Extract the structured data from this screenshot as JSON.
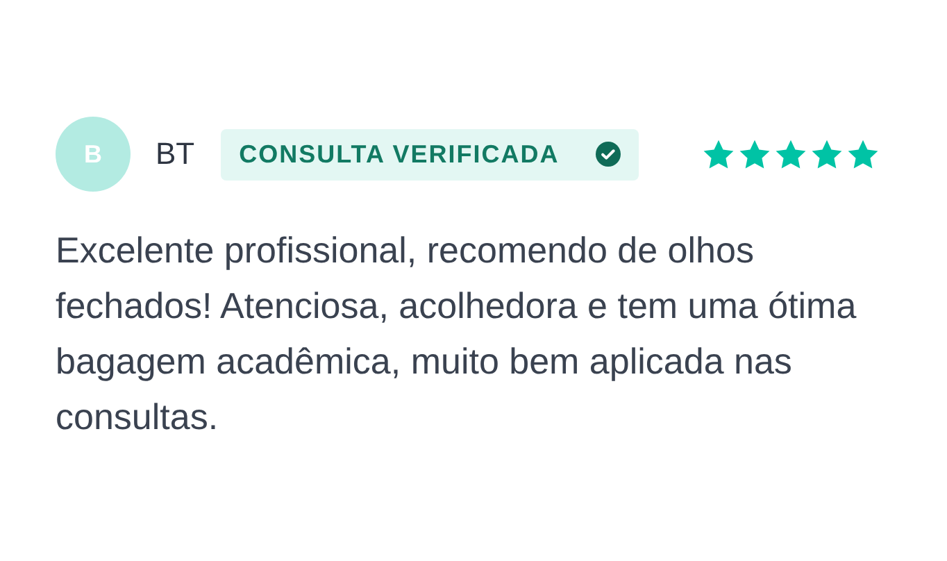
{
  "review": {
    "avatar_initial": "B",
    "author": "BT",
    "badge": "CONSULTA VERIFICADA",
    "stars": 5,
    "text": "Excelente profissional, recomendo de olhos fechados! Atenciosa, acolhedora e tem uma ótima bagagem acadêmica, muito bem aplicada nas consultas."
  }
}
